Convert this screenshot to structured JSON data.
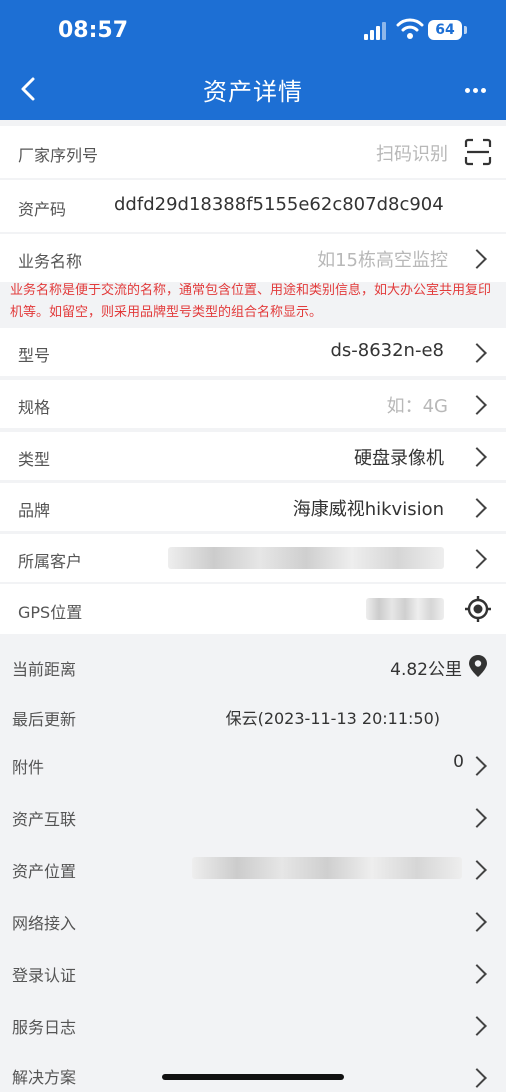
{
  "status": {
    "time": "08:57",
    "battery": "64"
  },
  "nav": {
    "title": "资产详情"
  },
  "rows": {
    "serial": {
      "label": "厂家序列号",
      "value": "扫码识别"
    },
    "asset_code": {
      "label": "资产码",
      "value": "ddfd29d18388f5155e62c807d8c904"
    },
    "business_name": {
      "label": "业务名称",
      "value": "如15栋高空监控"
    },
    "hint": "业务名称是便于交流的名称，通常包含位置、用途和类别信息，如大办公室共用复印机等。如留空，则采用品牌型号类型的组合名称显示。",
    "model": {
      "label": "型号",
      "value": "ds-8632n-e8"
    },
    "spec": {
      "label": "规格",
      "value": "如：4G"
    },
    "type": {
      "label": "类型",
      "value": "硬盘录像机"
    },
    "brand": {
      "label": "品牌",
      "value": "海康威视hikvision"
    },
    "customer": {
      "label": "所属客户"
    },
    "gps": {
      "label": "GPS位置"
    },
    "distance": {
      "label": "当前距离",
      "value": "4.82公里"
    },
    "last_update": {
      "label": "最后更新",
      "value": "保云(2023-11-13 20:11:50)"
    },
    "attachment": {
      "label": "附件",
      "value": "0"
    },
    "interconnect": {
      "label": "资产互联"
    },
    "location": {
      "label": "资产位置"
    },
    "network": {
      "label": "网络接入"
    },
    "login": {
      "label": "登录认证"
    },
    "service_log": {
      "label": "服务日志"
    },
    "solution": {
      "label": "解决方案"
    }
  }
}
